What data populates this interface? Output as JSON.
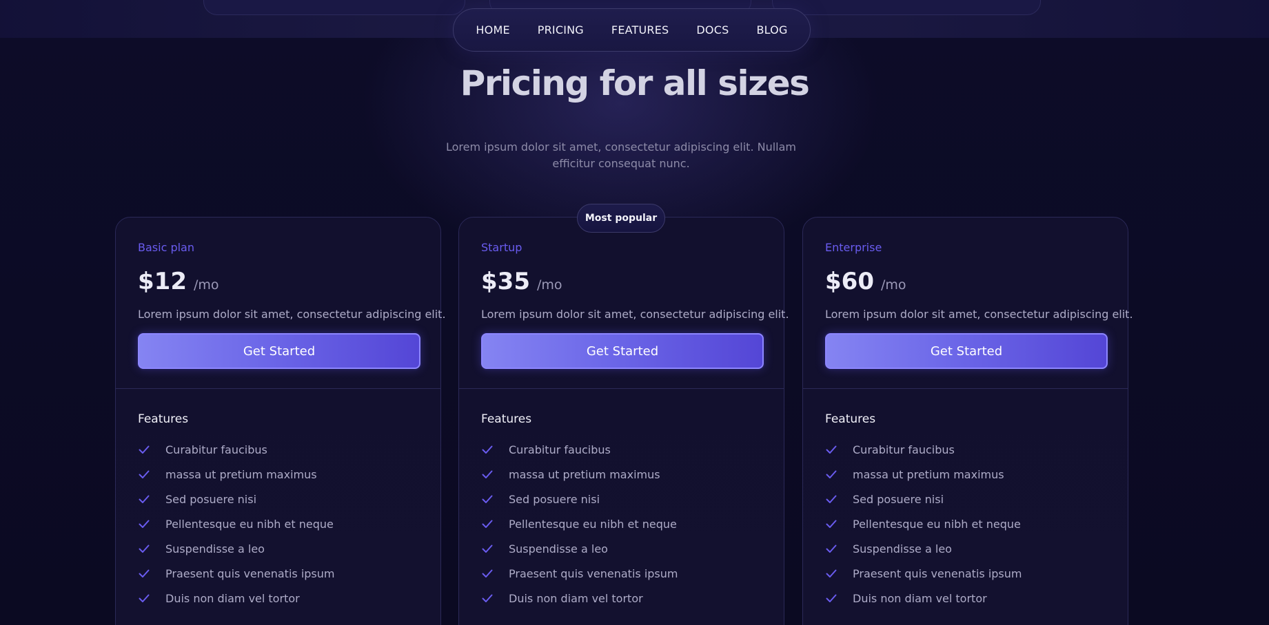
{
  "nav": {
    "items": [
      "HOME",
      "PRICING",
      "FEATURES",
      "DOCS",
      "BLOG"
    ]
  },
  "hero": {
    "title": "Pricing for all sizes",
    "subtitle": "Lorem ipsum dolor sit amet, consectetur adipiscing elit. Nullam efficitur consequat nunc."
  },
  "badge": "Most popular",
  "colors": {
    "accent": "#6a5cf0",
    "button_gradient_start": "#8584f2",
    "button_gradient_end": "#5446d6",
    "background": "#0b0a23"
  },
  "plans": [
    {
      "name": "Basic plan",
      "price": "$12",
      "period": "/mo",
      "description": "Lorem ipsum dolor sit amet, consectetur adipiscing elit.",
      "cta": "Get Started",
      "features_title": "Features",
      "features": [
        "Curabitur faucibus",
        "massa ut pretium maximus",
        "Sed posuere nisi",
        "Pellentesque eu nibh et neque",
        "Suspendisse a leo",
        "Praesent quis venenatis ipsum",
        "Duis non diam vel tortor"
      ]
    },
    {
      "name": "Startup",
      "price": "$35",
      "period": "/mo",
      "description": "Lorem ipsum dolor sit amet, consectetur adipiscing elit.",
      "cta": "Get Started",
      "features_title": "Features",
      "features": [
        "Curabitur faucibus",
        "massa ut pretium maximus",
        "Sed posuere nisi",
        "Pellentesque eu nibh et neque",
        "Suspendisse a leo",
        "Praesent quis venenatis ipsum",
        "Duis non diam vel tortor"
      ]
    },
    {
      "name": "Enterprise",
      "price": "$60",
      "period": "/mo",
      "description": "Lorem ipsum dolor sit amet, consectetur adipiscing elit.",
      "cta": "Get Started",
      "features_title": "Features",
      "features": [
        "Curabitur faucibus",
        "massa ut pretium maximus",
        "Sed posuere nisi",
        "Pellentesque eu nibh et neque",
        "Suspendisse a leo",
        "Praesent quis venenatis ipsum",
        "Duis non diam vel tortor"
      ]
    }
  ]
}
